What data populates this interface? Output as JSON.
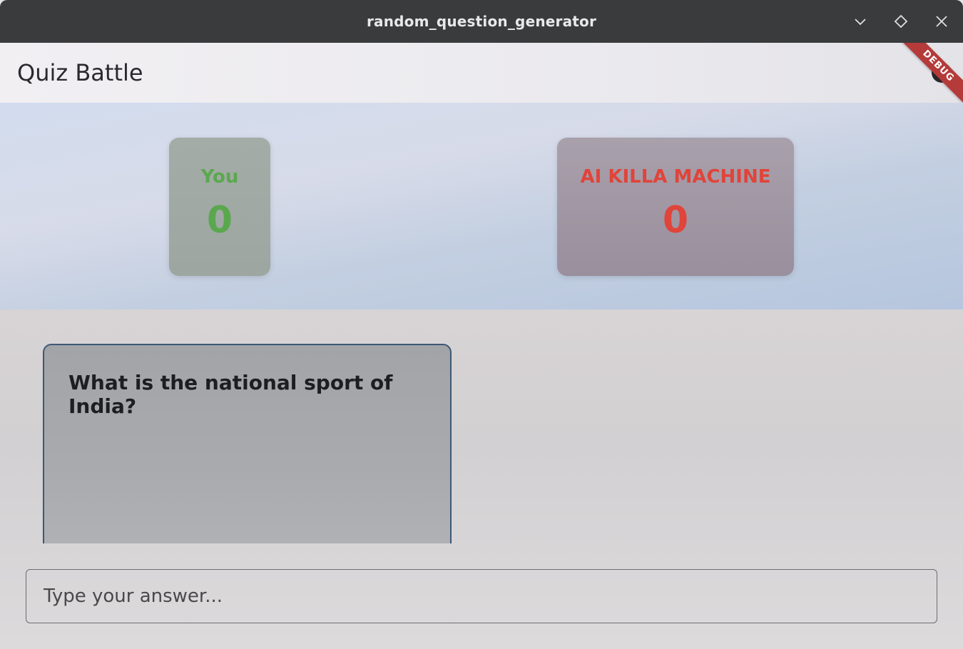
{
  "window": {
    "title": "random_question_generator",
    "buttons": {
      "minimize_icon": "chevron-down-icon",
      "maximize_icon": "diamond-icon",
      "close_icon": "close-icon"
    }
  },
  "appbar": {
    "title": "Quiz Battle"
  },
  "debug_banner": {
    "label": "DEBUG",
    "color": "#b53a3a"
  },
  "scores": {
    "player": {
      "name": "You",
      "score": "0",
      "color": "#5aa84e"
    },
    "opponent": {
      "name": "AI KILLA MACHINE",
      "score": "0",
      "color": "#e0443a"
    }
  },
  "question": {
    "text": "What is the national sport of India?"
  },
  "answer_input": {
    "placeholder": "Type your answer...",
    "value": ""
  }
}
